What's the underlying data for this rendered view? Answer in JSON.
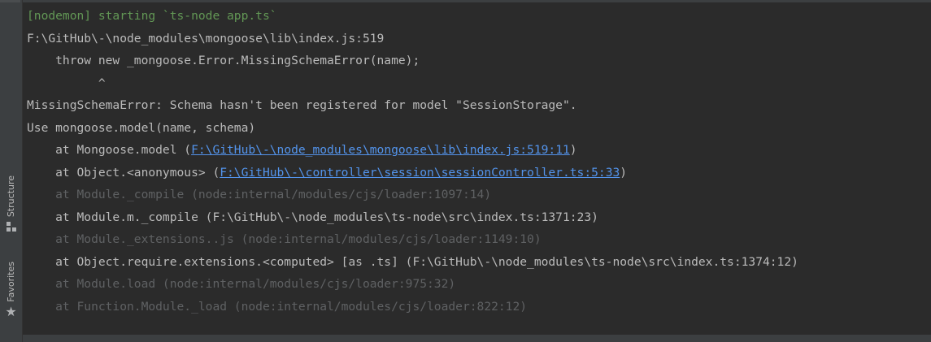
{
  "sidebar": {
    "structure_label": "Structure",
    "favorites_label": "Favorites",
    "structure_icon": "structure-icon",
    "favorites_icon": "star-icon"
  },
  "console": {
    "colors": {
      "background": "#2b2b2b",
      "text": "#bbbbbb",
      "nodemon": "#629755",
      "dimmed": "#5f6163",
      "link": "#5394ec"
    },
    "nodemon_line": "[nodemon] starting `ts-node app.ts`",
    "file_ref": "F:\\GitHub\\-\\node_modules\\mongoose\\lib\\index.js:519",
    "code_line": "    throw new _mongoose.Error.MissingSchemaError(name);",
    "caret_line": "          ^",
    "error_message": "MissingSchemaError: Schema hasn't been registered for model \"SessionStorage\".",
    "hint": "Use mongoose.model(name, schema)",
    "stack": {
      "frame1_prefix": "    at Mongoose.model (",
      "frame1_link": "F:\\GitHub\\-\\node_modules\\mongoose\\lib\\index.js:519:11",
      "frame1_suffix": ")",
      "frame2_prefix": "    at Object.<anonymous> (",
      "frame2_link": "F:\\GitHub\\-\\controller\\session\\sessionController.ts:5:33",
      "frame2_suffix": ")",
      "frame3": "    at Module._compile (node:internal/modules/cjs/loader:1097:14)",
      "frame4": "    at Module.m._compile (F:\\GitHub\\-\\node_modules\\ts-node\\src\\index.ts:1371:23)",
      "frame5": "    at Module._extensions..js (node:internal/modules/cjs/loader:1149:10)",
      "frame6": "    at Object.require.extensions.<computed> [as .ts] (F:\\GitHub\\-\\node_modules\\ts-node\\src\\index.ts:1374:12)",
      "frame7": "    at Module.load (node:internal/modules/cjs/loader:975:32)",
      "frame8": "    at Function.Module._load (node:internal/modules/cjs/loader:822:12)"
    }
  }
}
